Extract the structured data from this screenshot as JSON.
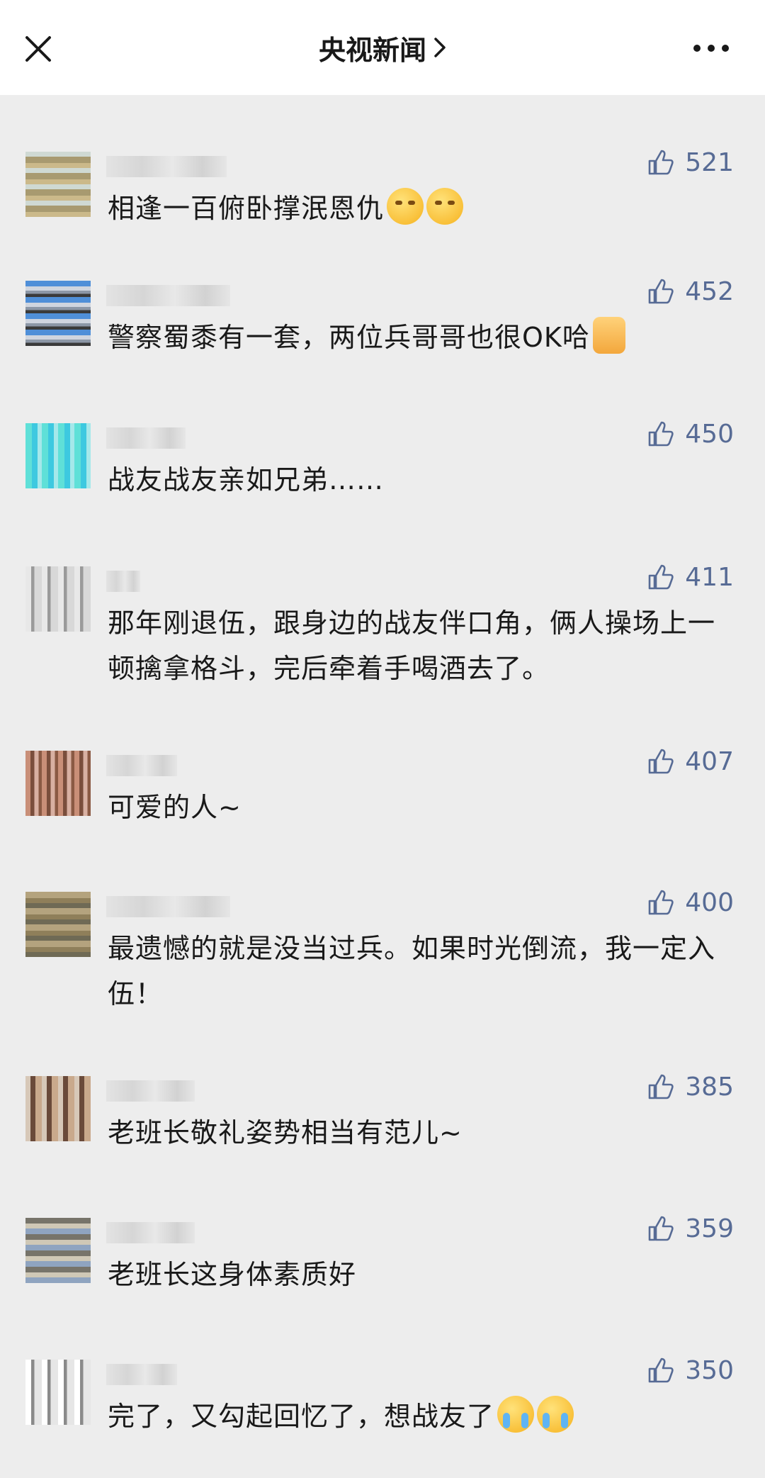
{
  "header": {
    "title": "央视新闻",
    "close_icon": "close-icon",
    "chevron_icon": "chevron-right-icon",
    "more_icon": "more-dots-icon"
  },
  "colors": {
    "like_count": "#576b95",
    "page_bg": "#ededed",
    "header_bg": "#ffffff"
  },
  "comments": [
    {
      "likes": "521",
      "text": "相逢一百俯卧撑泯恩仇",
      "emoji": [
        "smirk-face-emoji",
        "smirk-face-emoji"
      ]
    },
    {
      "likes": "452",
      "text": "警察蜀黍有一套，两位兵哥哥也很OK哈",
      "emoji": [
        "thumbs-up-emoji"
      ]
    },
    {
      "likes": "450",
      "text": "战友战友亲如兄弟……",
      "emoji": []
    },
    {
      "likes": "411",
      "text": "那年刚退伍，跟身边的战友伴口角，俩人操场上一顿擒拿格斗，完后牵着手喝酒去了。",
      "emoji": []
    },
    {
      "likes": "407",
      "text": "可爱的人~",
      "emoji": []
    },
    {
      "likes": "400",
      "text": "最遗憾的就是没当过兵。如果时光倒流，我一定入伍！",
      "emoji": []
    },
    {
      "likes": "385",
      "text": "老班长敬礼姿势相当有范儿~",
      "emoji": []
    },
    {
      "likes": "359",
      "text": "老班长这身体素质好",
      "emoji": []
    },
    {
      "likes": "350",
      "text": "完了，又勾起回忆了，想战友了",
      "emoji": [
        "crying-face-emoji",
        "crying-face-emoji"
      ]
    }
  ]
}
